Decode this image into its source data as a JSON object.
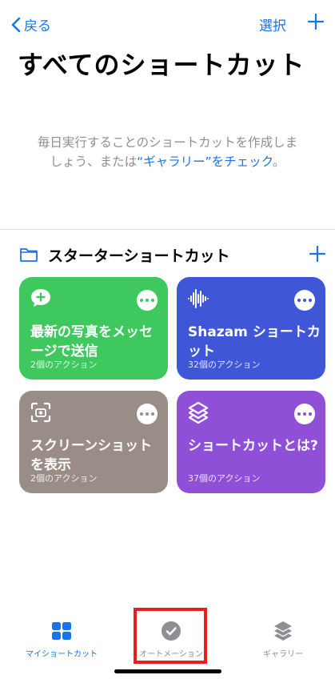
{
  "nav": {
    "back_label": "戻る",
    "select_label": "選択"
  },
  "page": {
    "title": "すべてのショートカット",
    "empty_text_1": "毎日実行することのショートカットを作成しま",
    "empty_text_2": "しょう、または",
    "empty_link": "“ギャラリー”をチェック",
    "empty_end": "。"
  },
  "section": {
    "title": "スターターショートカット"
  },
  "cards": [
    {
      "title": "最新の写真をメッセージで送信",
      "subtitle": "2個のアクション",
      "color": "#3ec85d",
      "icon": "message-plus-icon"
    },
    {
      "title": "Shazam ショートカット",
      "subtitle": "32個のアクション",
      "color": "#3f57d6",
      "icon": "waveform-icon"
    },
    {
      "title": "スクリーンショットを表示",
      "subtitle": "2個のアクション",
      "color": "#9a8d88",
      "icon": "screenshot-icon"
    },
    {
      "title": "ショートカットとは?",
      "subtitle": "37個のアクション",
      "color": "#8f4fd6",
      "icon": "shortcuts-layers-icon"
    }
  ],
  "tabs": [
    {
      "label": "マイショートカット",
      "icon": "grid-icon",
      "active": true
    },
    {
      "label": "オートメーション",
      "icon": "clock-check-icon",
      "active": false
    },
    {
      "label": "ギャラリー",
      "icon": "layers-icon",
      "active": false
    }
  ],
  "colors": {
    "accent": "#1a73e8",
    "highlight": "#e8201c"
  }
}
